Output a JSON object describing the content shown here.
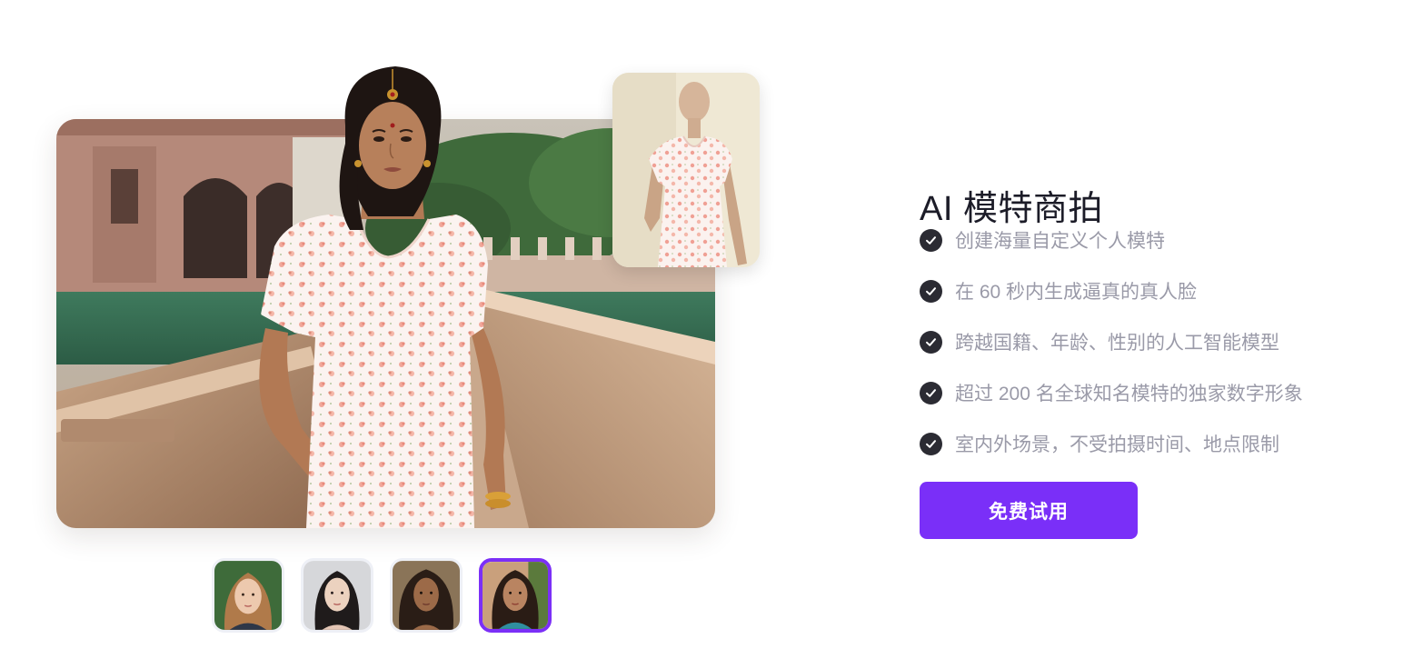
{
  "hero": {
    "alt": "AI model wearing floral dress in palace courtyard"
  },
  "mannequin": {
    "alt": "Dress on mannequin"
  },
  "thumbnails": [
    {
      "label": "model-1",
      "selected": false
    },
    {
      "label": "model-2",
      "selected": false
    },
    {
      "label": "model-3",
      "selected": false
    },
    {
      "label": "model-4",
      "selected": true
    }
  ],
  "section": {
    "title": "AI 模特商拍",
    "features": [
      "创建海量自定义个人模特",
      "在 60 秒内生成逼真的真人脸",
      "跨越国籍、年龄、性别的人工智能模型",
      "超过 200 名全球知名模特的独家数字形象",
      "室内外场景，不受拍摄时间、地点限制"
    ],
    "cta_label": "免费试用"
  },
  "colors": {
    "accent": "#7a2ff8",
    "title": "#1c1c28",
    "feature_text": "#9a9aa8",
    "check_bg": "#2b2b33"
  },
  "icons": {
    "feature_bullet": "check-circle-icon"
  }
}
